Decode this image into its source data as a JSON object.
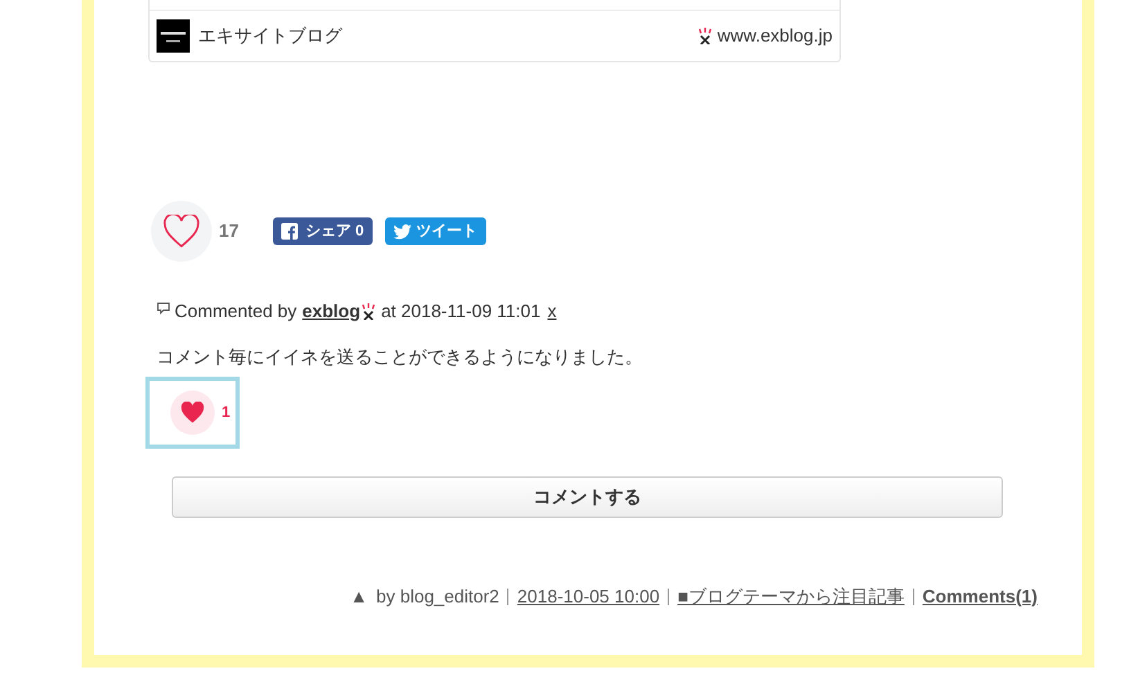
{
  "link_card": {
    "site_name": "エキサイトブログ",
    "url": "www.exblog.jp"
  },
  "post_like": {
    "liked": false,
    "count": "17"
  },
  "share_buttons": [
    {
      "kind": "facebook",
      "label": "シェア",
      "count": "0"
    },
    {
      "kind": "twitter",
      "label": "ツイート"
    }
  ],
  "comments": [
    {
      "prefix": "Commented by",
      "author": "exblog",
      "at": "at 2018-11-09 11:01",
      "delete": "x",
      "text": "コメント毎にイイネを送ることができるようになりました。",
      "like": {
        "liked": true,
        "count": "1",
        "selected": true
      }
    }
  ],
  "comment_button": "コメントする",
  "footer": {
    "mark": "▲",
    "by": "by blog_editor2",
    "date": "2018-10-05 10:00",
    "theme": "■ブログテーマから注目記事",
    "comments": "Comments(1)"
  }
}
